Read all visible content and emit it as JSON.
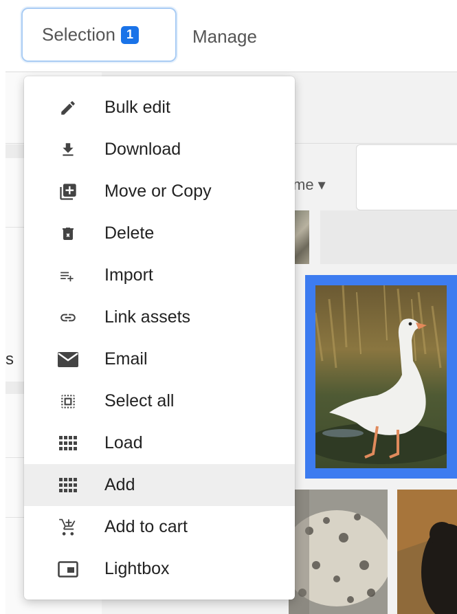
{
  "toolbar": {
    "selection_label": "Selection",
    "selection_count": "1",
    "manage_label": "Manage"
  },
  "background": {
    "sort_label": "me ▾",
    "left_letter": "s"
  },
  "menu": {
    "items": [
      {
        "label": "Bulk edit",
        "icon": "pencil-icon"
      },
      {
        "label": "Download",
        "icon": "download-icon"
      },
      {
        "label": "Move or Copy",
        "icon": "library-add-icon"
      },
      {
        "label": "Delete",
        "icon": "trash-icon"
      },
      {
        "label": "Import",
        "icon": "playlist-add-icon"
      },
      {
        "label": "Link assets",
        "icon": "link-icon"
      },
      {
        "label": "Email",
        "icon": "envelope-icon"
      },
      {
        "label": "Select all",
        "icon": "select-all-icon"
      },
      {
        "label": "Load",
        "icon": "grid-icon"
      },
      {
        "label": "Add",
        "icon": "grid-icon"
      },
      {
        "label": "Add to cart",
        "icon": "add-cart-icon"
      },
      {
        "label": "Lightbox",
        "icon": "lightbox-icon"
      }
    ],
    "highlighted_item": "Add"
  },
  "colors": {
    "accent": "#1a73e8",
    "selection_border": "#3d7cf0",
    "menu_hover": "#eeeeee"
  }
}
